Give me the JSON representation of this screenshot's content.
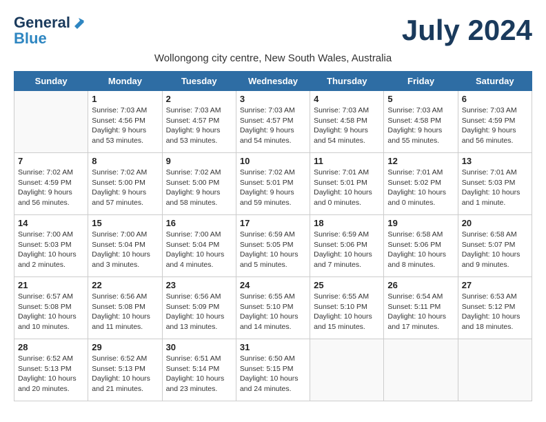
{
  "logo": {
    "line1": "General",
    "line2": "Blue"
  },
  "title": "July 2024",
  "subtitle": "Wollongong city centre, New South Wales, Australia",
  "days": [
    "Sunday",
    "Monday",
    "Tuesday",
    "Wednesday",
    "Thursday",
    "Friday",
    "Saturday"
  ],
  "weeks": [
    [
      {
        "day": "",
        "content": ""
      },
      {
        "day": "1",
        "content": "Sunrise: 7:03 AM\nSunset: 4:56 PM\nDaylight: 9 hours\nand 53 minutes."
      },
      {
        "day": "2",
        "content": "Sunrise: 7:03 AM\nSunset: 4:57 PM\nDaylight: 9 hours\nand 53 minutes."
      },
      {
        "day": "3",
        "content": "Sunrise: 7:03 AM\nSunset: 4:57 PM\nDaylight: 9 hours\nand 54 minutes."
      },
      {
        "day": "4",
        "content": "Sunrise: 7:03 AM\nSunset: 4:58 PM\nDaylight: 9 hours\nand 54 minutes."
      },
      {
        "day": "5",
        "content": "Sunrise: 7:03 AM\nSunset: 4:58 PM\nDaylight: 9 hours\nand 55 minutes."
      },
      {
        "day": "6",
        "content": "Sunrise: 7:03 AM\nSunset: 4:59 PM\nDaylight: 9 hours\nand 56 minutes."
      }
    ],
    [
      {
        "day": "7",
        "content": "Sunrise: 7:02 AM\nSunset: 4:59 PM\nDaylight: 9 hours\nand 56 minutes."
      },
      {
        "day": "8",
        "content": "Sunrise: 7:02 AM\nSunset: 5:00 PM\nDaylight: 9 hours\nand 57 minutes."
      },
      {
        "day": "9",
        "content": "Sunrise: 7:02 AM\nSunset: 5:00 PM\nDaylight: 9 hours\nand 58 minutes."
      },
      {
        "day": "10",
        "content": "Sunrise: 7:02 AM\nSunset: 5:01 PM\nDaylight: 9 hours\nand 59 minutes."
      },
      {
        "day": "11",
        "content": "Sunrise: 7:01 AM\nSunset: 5:01 PM\nDaylight: 10 hours\nand 0 minutes."
      },
      {
        "day": "12",
        "content": "Sunrise: 7:01 AM\nSunset: 5:02 PM\nDaylight: 10 hours\nand 0 minutes."
      },
      {
        "day": "13",
        "content": "Sunrise: 7:01 AM\nSunset: 5:03 PM\nDaylight: 10 hours\nand 1 minute."
      }
    ],
    [
      {
        "day": "14",
        "content": "Sunrise: 7:00 AM\nSunset: 5:03 PM\nDaylight: 10 hours\nand 2 minutes."
      },
      {
        "day": "15",
        "content": "Sunrise: 7:00 AM\nSunset: 5:04 PM\nDaylight: 10 hours\nand 3 minutes."
      },
      {
        "day": "16",
        "content": "Sunrise: 7:00 AM\nSunset: 5:04 PM\nDaylight: 10 hours\nand 4 minutes."
      },
      {
        "day": "17",
        "content": "Sunrise: 6:59 AM\nSunset: 5:05 PM\nDaylight: 10 hours\nand 5 minutes."
      },
      {
        "day": "18",
        "content": "Sunrise: 6:59 AM\nSunset: 5:06 PM\nDaylight: 10 hours\nand 7 minutes."
      },
      {
        "day": "19",
        "content": "Sunrise: 6:58 AM\nSunset: 5:06 PM\nDaylight: 10 hours\nand 8 minutes."
      },
      {
        "day": "20",
        "content": "Sunrise: 6:58 AM\nSunset: 5:07 PM\nDaylight: 10 hours\nand 9 minutes."
      }
    ],
    [
      {
        "day": "21",
        "content": "Sunrise: 6:57 AM\nSunset: 5:08 PM\nDaylight: 10 hours\nand 10 minutes."
      },
      {
        "day": "22",
        "content": "Sunrise: 6:56 AM\nSunset: 5:08 PM\nDaylight: 10 hours\nand 11 minutes."
      },
      {
        "day": "23",
        "content": "Sunrise: 6:56 AM\nSunset: 5:09 PM\nDaylight: 10 hours\nand 13 minutes."
      },
      {
        "day": "24",
        "content": "Sunrise: 6:55 AM\nSunset: 5:10 PM\nDaylight: 10 hours\nand 14 minutes."
      },
      {
        "day": "25",
        "content": "Sunrise: 6:55 AM\nSunset: 5:10 PM\nDaylight: 10 hours\nand 15 minutes."
      },
      {
        "day": "26",
        "content": "Sunrise: 6:54 AM\nSunset: 5:11 PM\nDaylight: 10 hours\nand 17 minutes."
      },
      {
        "day": "27",
        "content": "Sunrise: 6:53 AM\nSunset: 5:12 PM\nDaylight: 10 hours\nand 18 minutes."
      }
    ],
    [
      {
        "day": "28",
        "content": "Sunrise: 6:52 AM\nSunset: 5:13 PM\nDaylight: 10 hours\nand 20 minutes."
      },
      {
        "day": "29",
        "content": "Sunrise: 6:52 AM\nSunset: 5:13 PM\nDaylight: 10 hours\nand 21 minutes."
      },
      {
        "day": "30",
        "content": "Sunrise: 6:51 AM\nSunset: 5:14 PM\nDaylight: 10 hours\nand 23 minutes."
      },
      {
        "day": "31",
        "content": "Sunrise: 6:50 AM\nSunset: 5:15 PM\nDaylight: 10 hours\nand 24 minutes."
      },
      {
        "day": "",
        "content": ""
      },
      {
        "day": "",
        "content": ""
      },
      {
        "day": "",
        "content": ""
      }
    ]
  ]
}
